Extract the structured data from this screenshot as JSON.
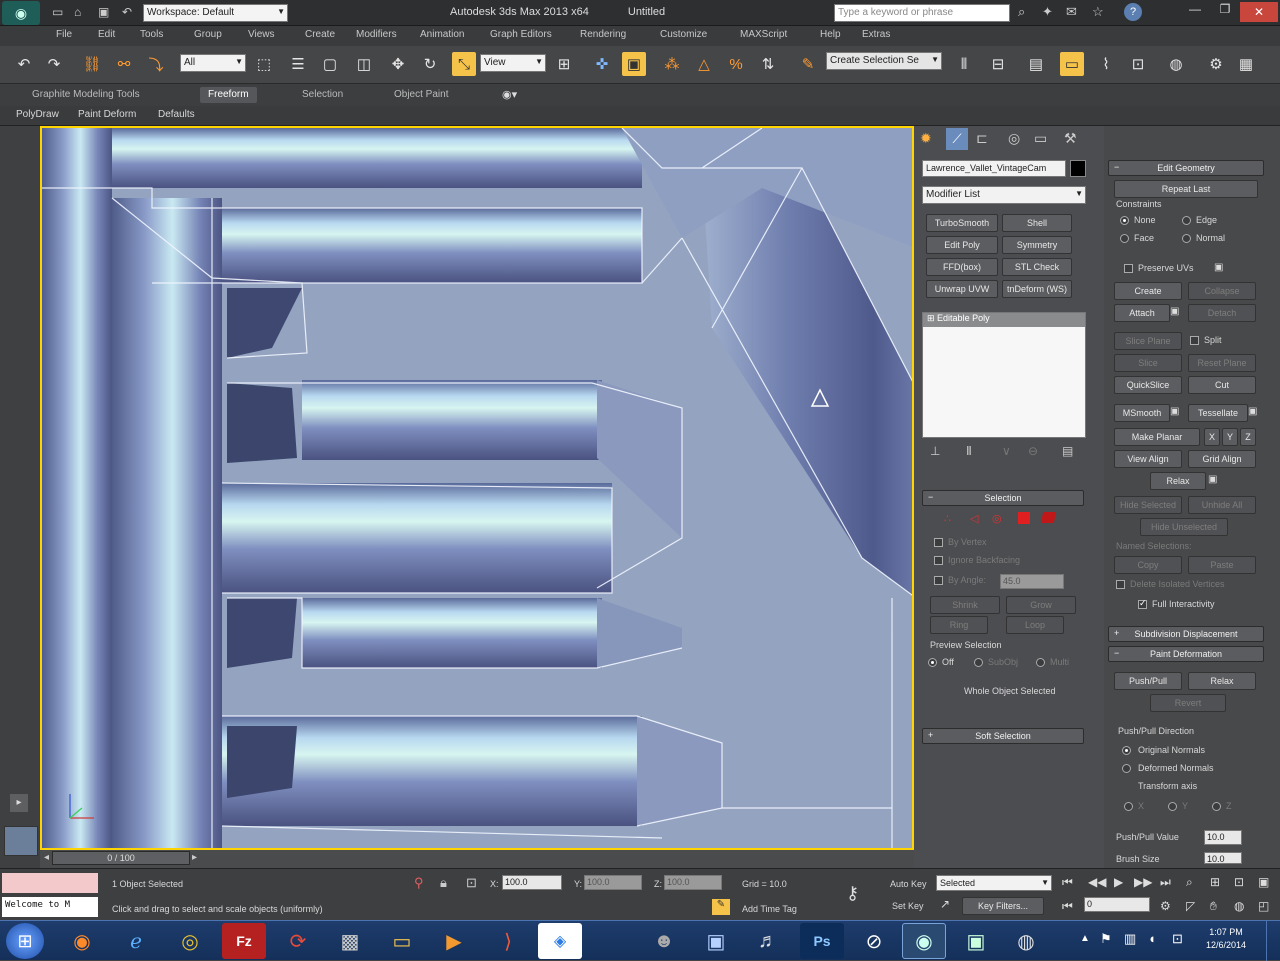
{
  "titlebar": {
    "workspace": "Workspace: Default",
    "title": "Autodesk 3ds Max  2013 x64",
    "doc": "Untitled",
    "search_placeholder": "Type a keyword or phrase"
  },
  "menu": [
    "Edit",
    "Tools",
    "Group",
    "Views",
    "Create",
    "Modifiers",
    "Animation",
    "Graph Editors",
    "Rendering",
    "Customize",
    "MAXScript",
    "Help",
    "Extras"
  ],
  "menu_file": "File",
  "toolbar": {
    "filter": "All",
    "ref_coord": "View",
    "selection_set": "Create Selection Se"
  },
  "ribbon": {
    "tabs": [
      "Graphite Modeling Tools",
      "Freeform",
      "Selection",
      "Object Paint"
    ],
    "active": "Freeform",
    "sub": [
      "PolyDraw",
      "Paint Deform",
      "Defaults"
    ]
  },
  "viewport": {
    "frame_counter": "0 / 100"
  },
  "command_panel": {
    "object_name": "Lawrence_Vallet_VintageCam",
    "modifier_list": "Modifier List",
    "modifier_buttons": [
      "TurboSmooth",
      "Shell",
      "Edit Poly",
      "Symmetry",
      "FFD(box)",
      "STL Check",
      "Unwrap UVW",
      "tnDeform (WS)"
    ],
    "stack_item": "Editable Poly",
    "selection_rollout": "Selection",
    "by_vertex": "By Vertex",
    "ignore_backfacing": "Ignore Backfacing",
    "by_angle": "By Angle:",
    "by_angle_value": "45.0",
    "shrink": "Shrink",
    "grow": "Grow",
    "ring": "Ring",
    "loop": "Loop",
    "preview_selection": "Preview Selection",
    "preview_opts": [
      "Off",
      "SubObj",
      "Multi"
    ],
    "whole_object": "Whole Object Selected",
    "soft_selection": "Soft Selection"
  },
  "right_panel": {
    "edit_geometry": "Edit Geometry",
    "repeat_last": "Repeat Last",
    "constraints": "Constraints",
    "constraint_opts": [
      "None",
      "Edge",
      "Face",
      "Normal"
    ],
    "preserve_uvs": "Preserve UVs",
    "create": "Create",
    "collapse": "Collapse",
    "attach": "Attach",
    "detach": "Detach",
    "slice_plane": "Slice Plane",
    "split": "Split",
    "slice": "Slice",
    "reset_plane": "Reset Plane",
    "quickslice": "QuickSlice",
    "cut": "Cut",
    "msmooth": "MSmooth",
    "tessellate": "Tessellate",
    "make_planar": "Make Planar",
    "xyz": [
      "X",
      "Y",
      "Z"
    ],
    "view_align": "View Align",
    "grid_align": "Grid Align",
    "relax": "Relax",
    "hide_selected": "Hide Selected",
    "unhide_all": "Unhide All",
    "hide_unselected": "Hide Unselected",
    "named_selections": "Named Selections:",
    "copy": "Copy",
    "paste": "Paste",
    "delete_isolated": "Delete Isolated Vertices",
    "full_interactivity": "Full Interactivity",
    "subdivision_displacement": "Subdivision Displacement",
    "paint_deformation": "Paint Deformation",
    "push_pull": "Push/Pull",
    "relax2": "Relax",
    "revert": "Revert",
    "push_pull_direction": "Push/Pull Direction",
    "direction_opts": [
      "Original Normals",
      "Deformed Normals",
      "Transform axis"
    ],
    "axis_opts": [
      "X",
      "Y",
      "Z"
    ],
    "push_pull_value_label": "Push/Pull Value",
    "push_pull_value": "10.0",
    "brush_size_label": "Brush Size",
    "brush_size": "10.0"
  },
  "status": {
    "selected": "1 Object Selected",
    "hint": "Click and drag to select and scale objects (uniformly)",
    "maxscript": "Welcome to M",
    "x_label": "X:",
    "x": "100.0",
    "y_label": "Y:",
    "y": "100.0",
    "z_label": "Z:",
    "z": "100.0",
    "grid": "Grid = 10.0",
    "add_time_tag": "Add Time Tag",
    "auto_key": "Auto Key",
    "set_key": "Set Key",
    "auto_key_value": "Selected",
    "key_filters": "Key Filters...",
    "frame": "0"
  },
  "taskbar": {
    "time": "1:07 PM",
    "date": "12/6/2014"
  }
}
